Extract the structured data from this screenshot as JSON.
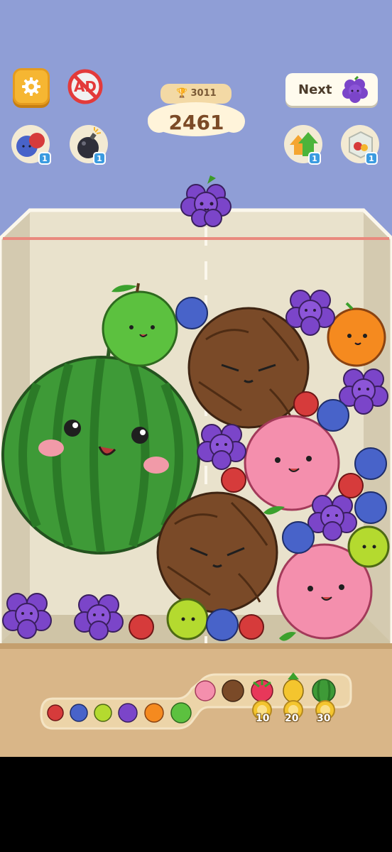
{
  "header": {
    "next_label": "Next",
    "best_score": "3011",
    "current_score": "2461"
  },
  "powerups": [
    {
      "name": "merge",
      "count": "1"
    },
    {
      "name": "bomb",
      "count": "1"
    },
    {
      "name": "upgrade",
      "count": "1"
    },
    {
      "name": "box",
      "count": "1"
    }
  ],
  "evolution": {
    "coins": [
      "10",
      "20",
      "30"
    ]
  },
  "colors": {
    "background": "#8f9ed6",
    "container": "#e6dfc8",
    "floor": "#d9b688",
    "danger_line": "#e98a7e"
  }
}
